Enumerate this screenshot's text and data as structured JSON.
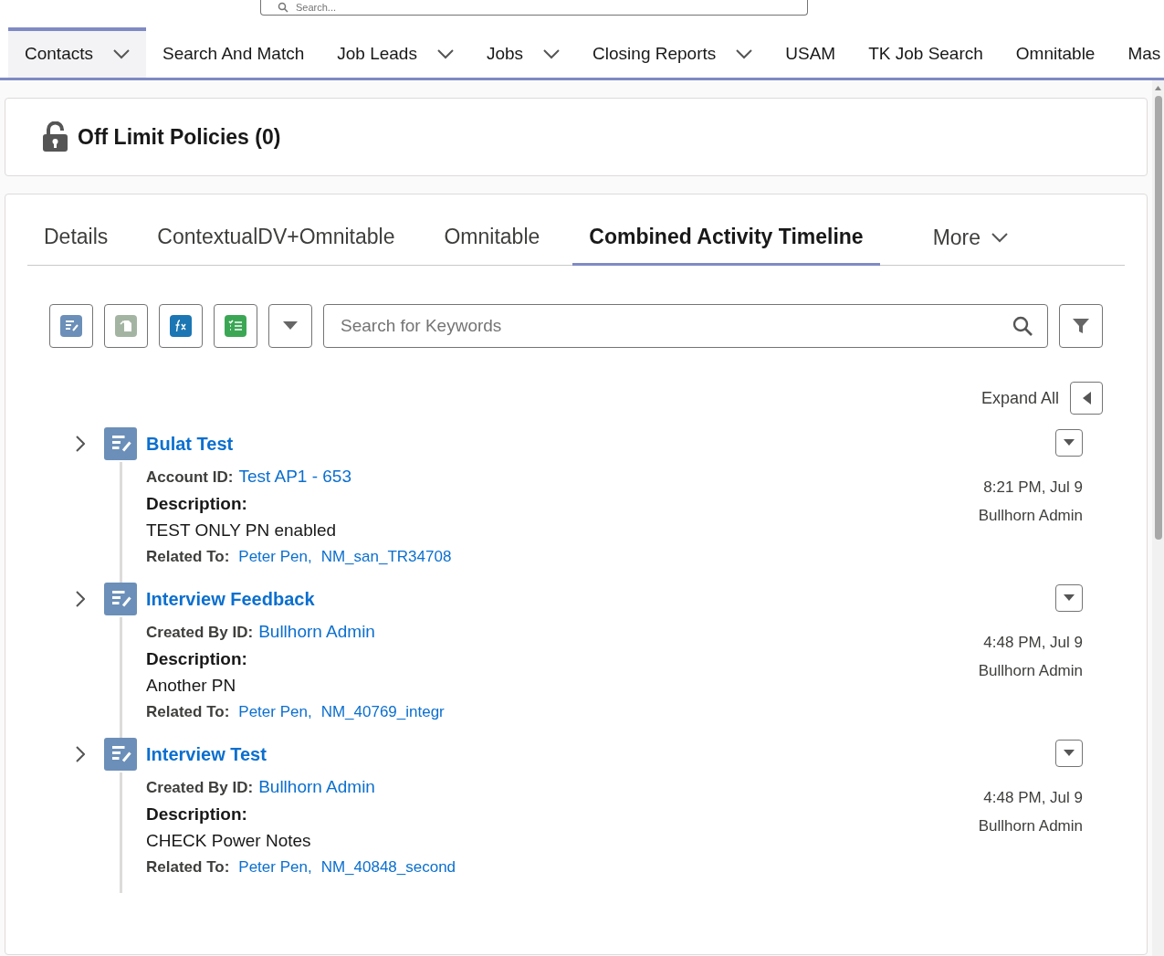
{
  "global_search": {
    "placeholder": "Search..."
  },
  "nav_tabs": [
    {
      "label": "Contacts",
      "selected": true,
      "has_menu": true
    },
    {
      "label": "Search And Match",
      "selected": false,
      "has_menu": false
    },
    {
      "label": "Job Leads",
      "selected": false,
      "has_menu": true
    },
    {
      "label": "Jobs",
      "selected": false,
      "has_menu": true
    },
    {
      "label": "Closing Reports",
      "selected": false,
      "has_menu": true
    },
    {
      "label": "USAM",
      "selected": false,
      "has_menu": false
    },
    {
      "label": "TK Job Search",
      "selected": false,
      "has_menu": false
    },
    {
      "label": "Omnitable",
      "selected": false,
      "has_menu": false
    },
    {
      "label": "Mas",
      "selected": false
    }
  ],
  "off_limit_card": {
    "title": "Off Limit Policies (0)"
  },
  "record_tabs": [
    {
      "label": "Details",
      "selected": false
    },
    {
      "label": "ContextualDV+Omnitable",
      "selected": false
    },
    {
      "label": "Omnitable",
      "selected": false
    },
    {
      "label": "Combined Activity Timeline",
      "selected": true
    }
  ],
  "more_tab": {
    "label": "More"
  },
  "search": {
    "placeholder": "Search for Keywords"
  },
  "expand_all": {
    "label": "Expand All"
  },
  "timeline": [
    {
      "title": "Bulat Test",
      "expanded": false,
      "time": "8:21 PM, Jul 9",
      "user": "Bullhorn Admin",
      "fields": [
        {
          "kind": "field",
          "label": "Account ID:",
          "value": "Test AP1 - 653"
        },
        {
          "kind": "heading",
          "label": "Description:"
        },
        {
          "kind": "text",
          "value": "TEST ONLY PN enabled"
        },
        {
          "kind": "related",
          "label": "Related To:",
          "links": [
            "Peter Pen,",
            "NM_san_TR34708"
          ]
        }
      ]
    },
    {
      "title": "Interview Feedback",
      "expanded": false,
      "time": "4:48 PM, Jul 9",
      "user": "Bullhorn Admin",
      "fields": [
        {
          "kind": "field",
          "label": "Created By ID:",
          "value": "Bullhorn Admin"
        },
        {
          "kind": "heading",
          "label": "Description:"
        },
        {
          "kind": "text",
          "value": "Another PN"
        },
        {
          "kind": "related",
          "label": "Related To:",
          "links": [
            "Peter Pen,",
            "NM_40769_integr"
          ]
        }
      ]
    },
    {
      "title": "Interview Test",
      "expanded": false,
      "time": "4:48 PM, Jul 9",
      "user": "Bullhorn Admin",
      "fields": [
        {
          "kind": "field",
          "label": "Created By ID:",
          "value": "Bullhorn Admin"
        },
        {
          "kind": "heading",
          "label": "Description:"
        },
        {
          "kind": "text",
          "value": "CHECK Power Notes"
        },
        {
          "kind": "related",
          "label": "Related To:",
          "links": [
            "Peter Pen,",
            "NM_40848_second"
          ]
        }
      ]
    }
  ]
}
